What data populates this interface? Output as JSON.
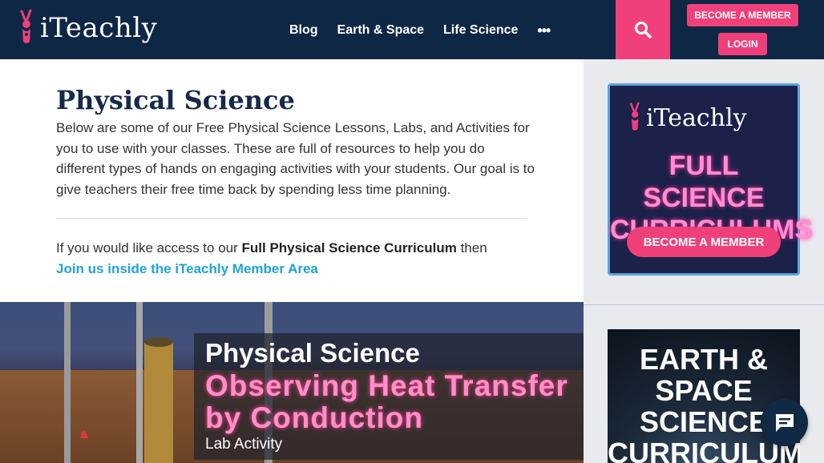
{
  "brand": {
    "name": "iTeachly"
  },
  "nav": {
    "items": [
      {
        "label": "Blog"
      },
      {
        "label": "Earth & Space"
      },
      {
        "label": "Life Science"
      }
    ],
    "more_label": "•••"
  },
  "header": {
    "become_member_label": "BECOME A MEMBER",
    "login_label": "LOGIN"
  },
  "main": {
    "title": "Physical Science",
    "intro": "Below are some of our Free Physical Science Lessons, Labs, and Activities for you to use with your classes. These are full of resources to help you do different types of hands on engaging activities with your students. Our goal is to give teachers their free time back by spending less time planning.",
    "access_prefix": "If you would like access to our ",
    "access_bold": "Full Physical Science Curriculum",
    "access_suffix": " then",
    "member_link": "Join us inside the iTeachly Member Area"
  },
  "hero": {
    "title": "Physical Science",
    "subtitle": "Observing Heat Transfer by Conduction",
    "caption": "Lab Activity"
  },
  "sidebar": {
    "ad1": {
      "logo_text": "iTeachly",
      "title_line1": "FULL SCIENCE",
      "title_line2": "CURRICULUMS",
      "button_label": "BECOME A MEMBER"
    },
    "ad2": {
      "title_line1": "EARTH &",
      "title_line2": "SPACE",
      "title_line3": "SCIENCE",
      "title_line4": "CURRICULUM"
    }
  },
  "colors": {
    "header_bg": "#0e2745",
    "accent_pink": "#f0407a",
    "link_blue": "#1fa3d8",
    "title_navy": "#16294a"
  },
  "icons": {
    "logo": "bunny-logo-icon",
    "search": "search-icon",
    "chat": "chat-icon"
  }
}
